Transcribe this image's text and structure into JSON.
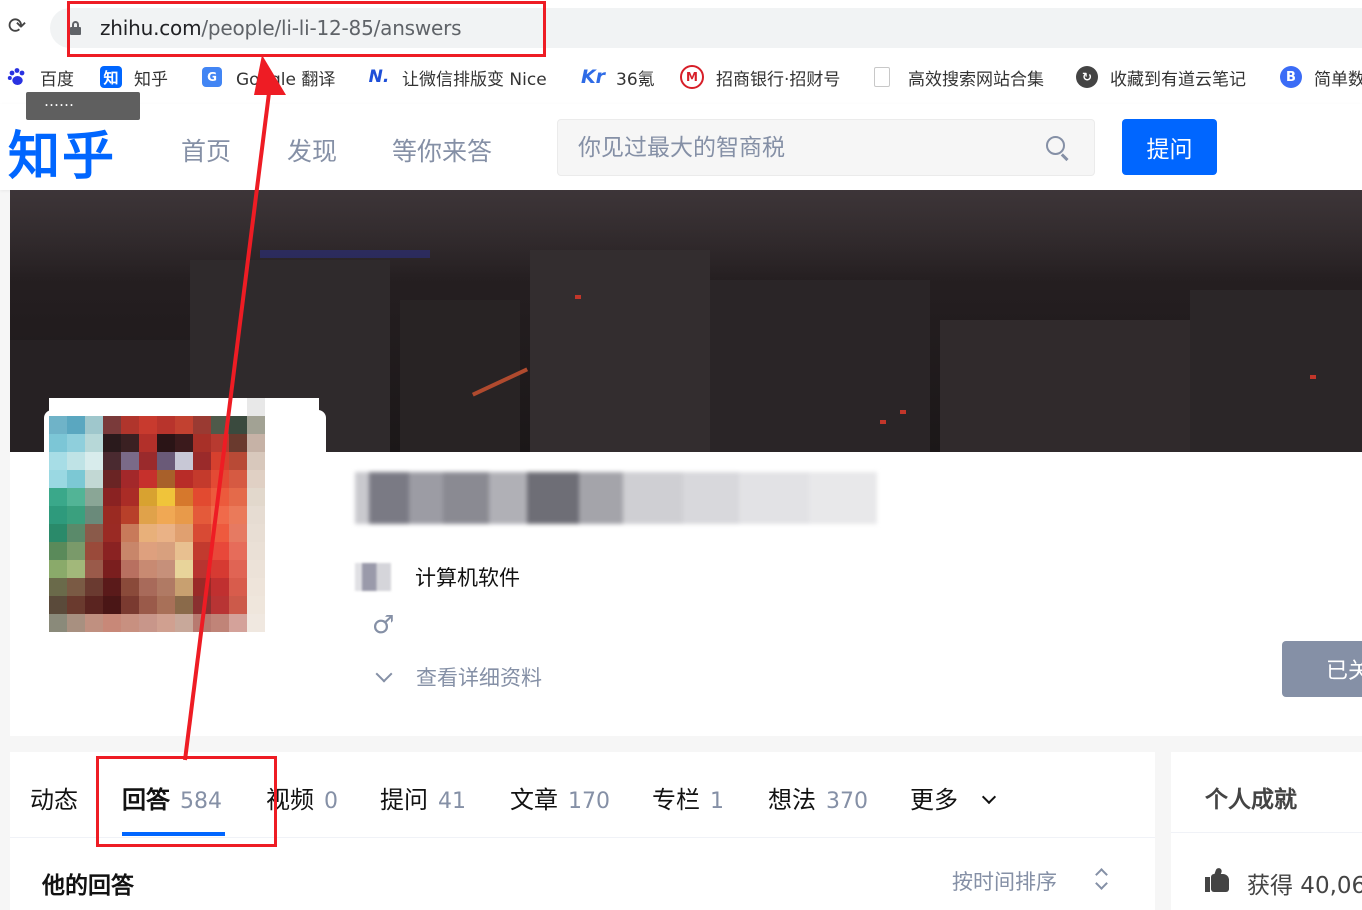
{
  "browser": {
    "url_domain": "zhihu.com",
    "url_path": "/people/li-li-12-85/answers",
    "reload_glyph": "⟳",
    "bookmarks": [
      {
        "label": "百度",
        "icon": "baidu-paw-icon",
        "color": "#2932e1"
      },
      {
        "label": "知乎",
        "icon": "zhihu-icon",
        "color": "#0066ff"
      },
      {
        "label": "Google 翻译",
        "icon": "google-translate-icon",
        "color": "#4285f4"
      },
      {
        "label": "让微信排版变 Nice",
        "icon": "nice-icon",
        "color": "#1e4fd8"
      },
      {
        "label": "36氪",
        "icon": "36kr-icon",
        "color": "#2e6be6"
      },
      {
        "label": "招商银行·招财号",
        "icon": "cmb-icon",
        "color": "#d71e28"
      },
      {
        "label": "高效搜索网站合集",
        "icon": "document-icon",
        "color": "#bdbdbd"
      },
      {
        "label": "收藏到有道云笔记",
        "icon": "youdao-icon",
        "color": "#444444"
      },
      {
        "label": "简单数",
        "icon": "b-icon",
        "color": "#3b6cf6"
      }
    ],
    "tooltip_text": "……"
  },
  "header": {
    "logo": "知乎",
    "nav": [
      "首页",
      "发现",
      "等你来答"
    ],
    "search_placeholder": "你见过最大的智商税",
    "ask_button": "提问"
  },
  "profile": {
    "occupation": "计算机软件",
    "gender_glyph": "♂",
    "detail_link": "查看详细资料",
    "follow_button": "已关注"
  },
  "tabs": [
    {
      "label": "动态",
      "count": ""
    },
    {
      "label": "回答",
      "count": "584",
      "active": true
    },
    {
      "label": "视频",
      "count": "0"
    },
    {
      "label": "提问",
      "count": "41"
    },
    {
      "label": "文章",
      "count": "170"
    },
    {
      "label": "专栏",
      "count": "1"
    },
    {
      "label": "想法",
      "count": "370"
    },
    {
      "label": "更多",
      "count": ""
    }
  ],
  "answers_section": {
    "title": "他的回答",
    "sort_label": "按时间排序"
  },
  "sidebar": {
    "title": "个人成就",
    "likes_text": "获得 40,06"
  },
  "colors": {
    "brand": "#0066ff",
    "muted": "#8590a6",
    "annotation": "#ee1c24"
  }
}
